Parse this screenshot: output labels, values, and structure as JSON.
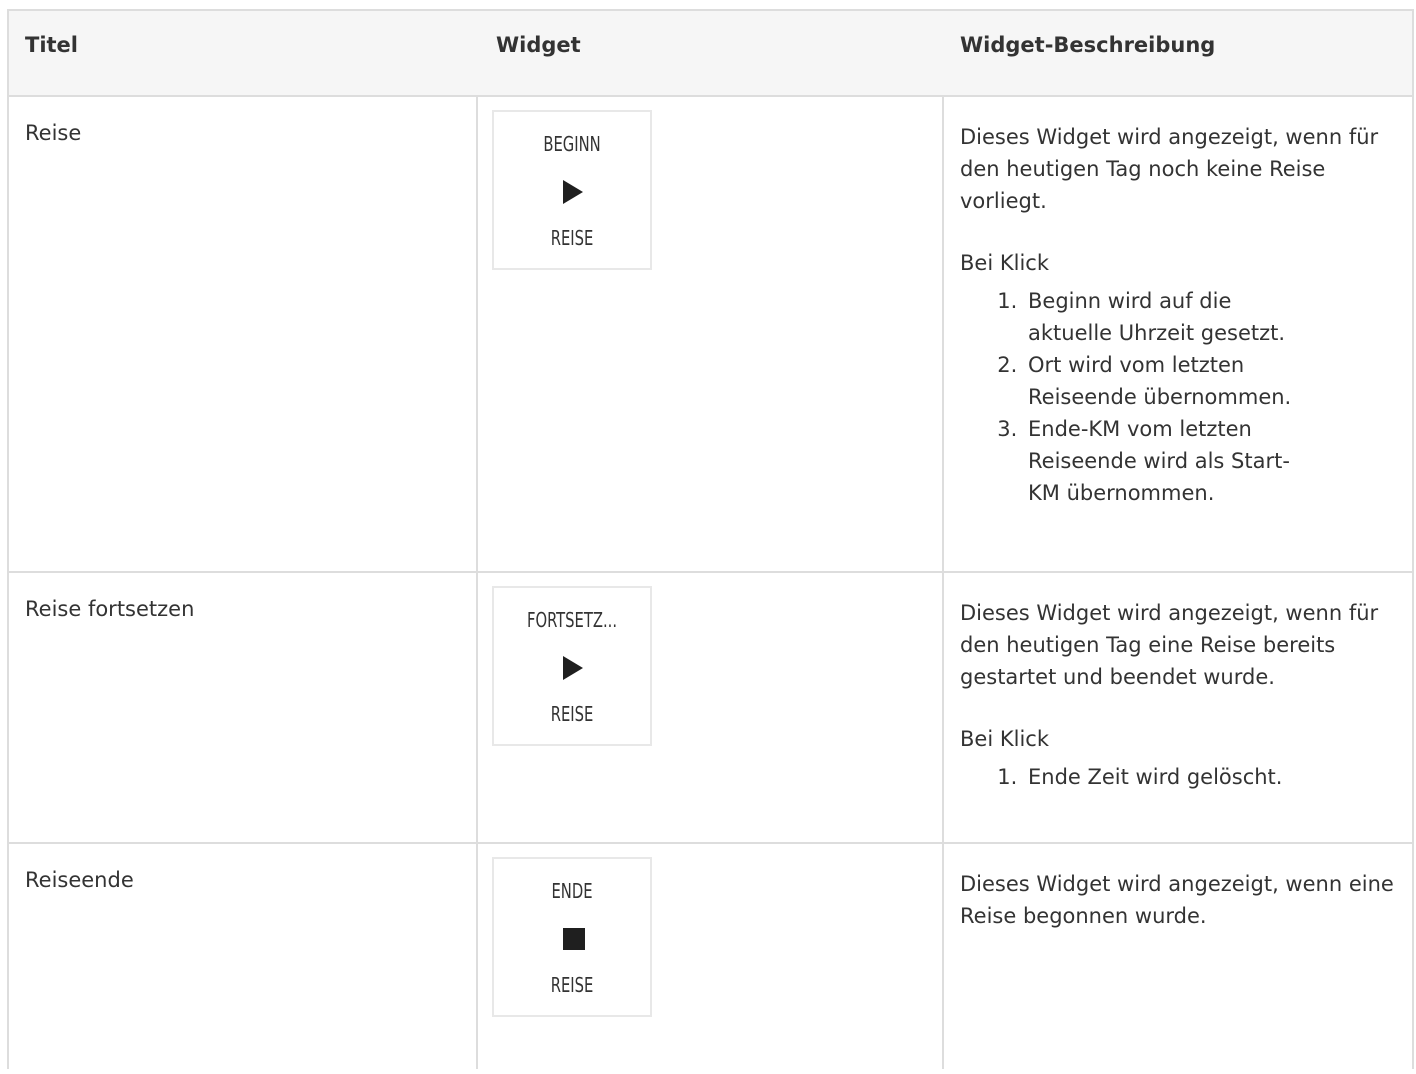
{
  "header": {
    "col_title": "Titel",
    "col_widget": "Widget",
    "col_description": "Widget-Beschreibung"
  },
  "rows": [
    {
      "title": "Reise",
      "widget": {
        "top": "BEGINN",
        "icon": "play-icon",
        "bottom": "REISE"
      },
      "description": "Dieses Widget wird angezeigt, wenn für den heutigen Tag noch keine Reise vorliegt.",
      "click_label": "Bei Klick",
      "steps": [
        "Beginn wird auf die aktuelle Uhrzeit gesetzt.",
        "Ort wird vom letzten Reiseende übernommen.",
        "Ende-KM vom letzten Reiseende wird als Start-KM übernommen."
      ]
    },
    {
      "title": "Reise fortsetzen",
      "widget": {
        "top": "FORTSETZ...",
        "icon": "play-icon",
        "bottom": "REISE"
      },
      "description": "Dieses Widget wird angezeigt, wenn für den heutigen Tag eine Reise bereits gestartet und beendet wurde.",
      "click_label": "Bei Klick",
      "steps": [
        "Ende Zeit wird gelöscht."
      ]
    },
    {
      "title": "Reiseende",
      "widget": {
        "top": "ENDE",
        "icon": "stop-icon",
        "bottom": "REISE"
      },
      "description": "Dieses Widget wird angezeigt, wenn eine Reise begonnen wurde."
    }
  ],
  "colors": {
    "border": "#dddddd",
    "header_bg": "#f6f6f6",
    "text": "#333333",
    "icon": "#1f1f1f"
  }
}
